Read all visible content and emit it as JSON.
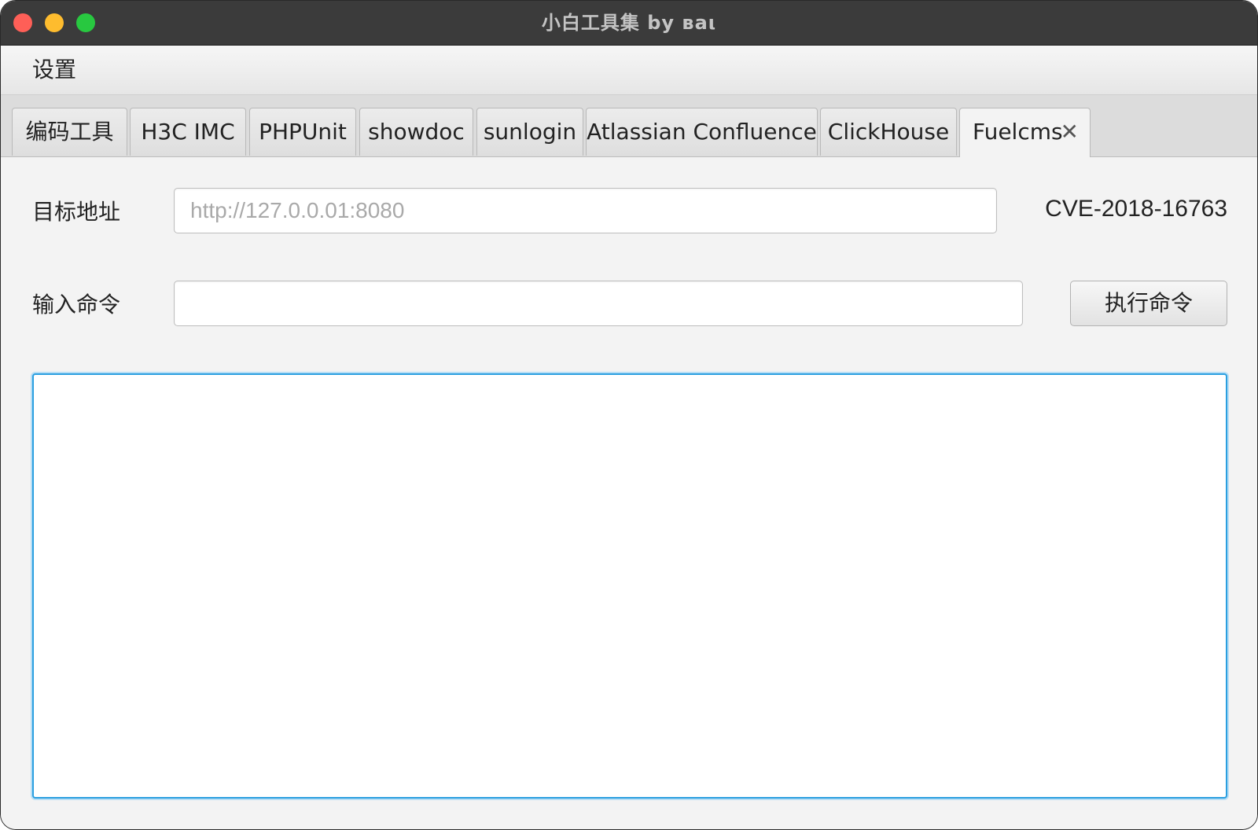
{
  "window": {
    "title": "小白工具集  by ʙaι"
  },
  "menubar": {
    "items": [
      {
        "label": "设置"
      }
    ]
  },
  "tabs": [
    {
      "label": "编码工具"
    },
    {
      "label": "H3C IMC"
    },
    {
      "label": "PHPUnit"
    },
    {
      "label": "showdoc"
    },
    {
      "label": "sunlogin"
    },
    {
      "label": "Atlassian Confluence"
    },
    {
      "label": "ClickHouse"
    },
    {
      "label": "Fuelcms",
      "active": true,
      "close_glyph": "✕"
    }
  ],
  "form": {
    "target": {
      "label": "目标地址",
      "placeholder": "http://127.0.0.01:8080",
      "value": ""
    },
    "cve_id": "CVE-2018-16763",
    "command": {
      "label": "输入命令",
      "placeholder": "",
      "value": ""
    },
    "execute_label": "执行命令"
  },
  "output": {
    "text": ""
  },
  "colors": {
    "titlebar": "#3b3b3b",
    "accent_focus": "#2a9fe0",
    "close": "#fe5f57",
    "minimize": "#febc2e",
    "maximize": "#28c840"
  }
}
